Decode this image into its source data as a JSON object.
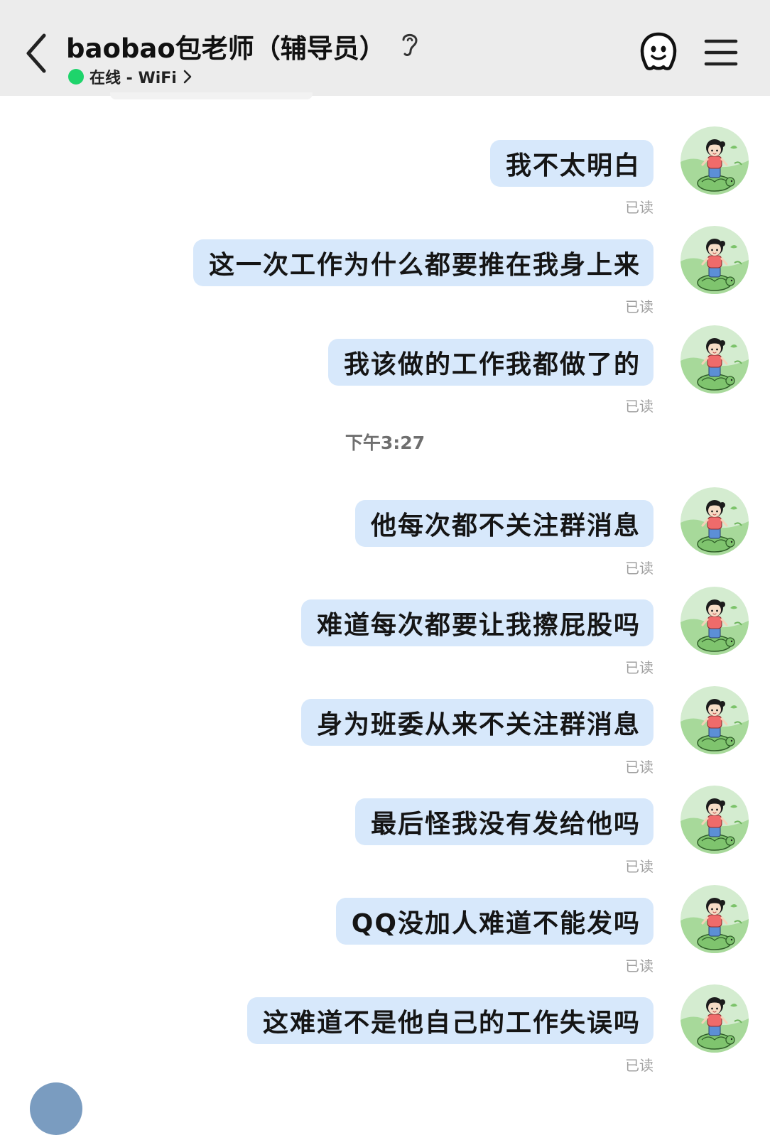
{
  "header": {
    "title": "baobao包老师（辅导员）",
    "status_text": "在线 - WiFi",
    "status_color": "#1ed46b",
    "icons": {
      "back": "chevron-left-icon",
      "ear": "ear-icon",
      "robot": "robot-face-icon",
      "menu": "hamburger-menu-icon"
    }
  },
  "chat": {
    "timestamp": "下午3:27",
    "read_label": "已读",
    "messages": [
      {
        "text": "我不太明白",
        "read": "已读"
      },
      {
        "text": "这一次工作为什么都要推在我身上来",
        "read": "已读"
      },
      {
        "text": "我该做的工作我都做了的",
        "read": "已读"
      },
      {
        "text": "他每次都不关注群消息",
        "read": "已读"
      },
      {
        "text": "难道每次都要让我擦屁股吗",
        "read": "已读"
      },
      {
        "text": "身为班委从来不关注群消息",
        "read": "已读"
      },
      {
        "text": "最后怪我没有发给他吗",
        "read": "已读"
      },
      {
        "text": "QQ没加人难道不能发吗",
        "read": "已读"
      },
      {
        "text": "这难道不是他自己的工作失误吗",
        "read": "已读"
      }
    ]
  },
  "colors": {
    "header_bg": "#ececec",
    "bubble_bg": "#d7e8fb",
    "read_text": "#a0a0a0"
  }
}
